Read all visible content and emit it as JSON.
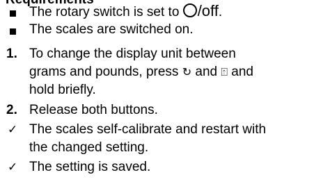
{
  "heading": "Requirements",
  "requirements": [
    {
      "before": "The rotary switch is set to ",
      "icon": "off-circle-icon",
      "after": "/off",
      "after2": "."
    },
    {
      "text": "The scales are switched on."
    }
  ],
  "steps": [
    {
      "number": "1.",
      "line1": "To change the display unit between",
      "line2_before": "grams and pounds, press ",
      "icon1": "rotate-icon",
      "icon1_glyph": "↻",
      "and": " and ",
      "icon2": "scale-icon",
      "icon2_glyph": "⍐",
      "line2_after": " and",
      "line3": "hold briefly."
    },
    {
      "number": "2.",
      "text": "Release both buttons."
    }
  ],
  "results": [
    {
      "mark": "✓",
      "line1": "The scales self-calibrate and restart with",
      "line2": "the changed setting."
    },
    {
      "mark": "✓",
      "line1": "The setting is saved."
    }
  ]
}
